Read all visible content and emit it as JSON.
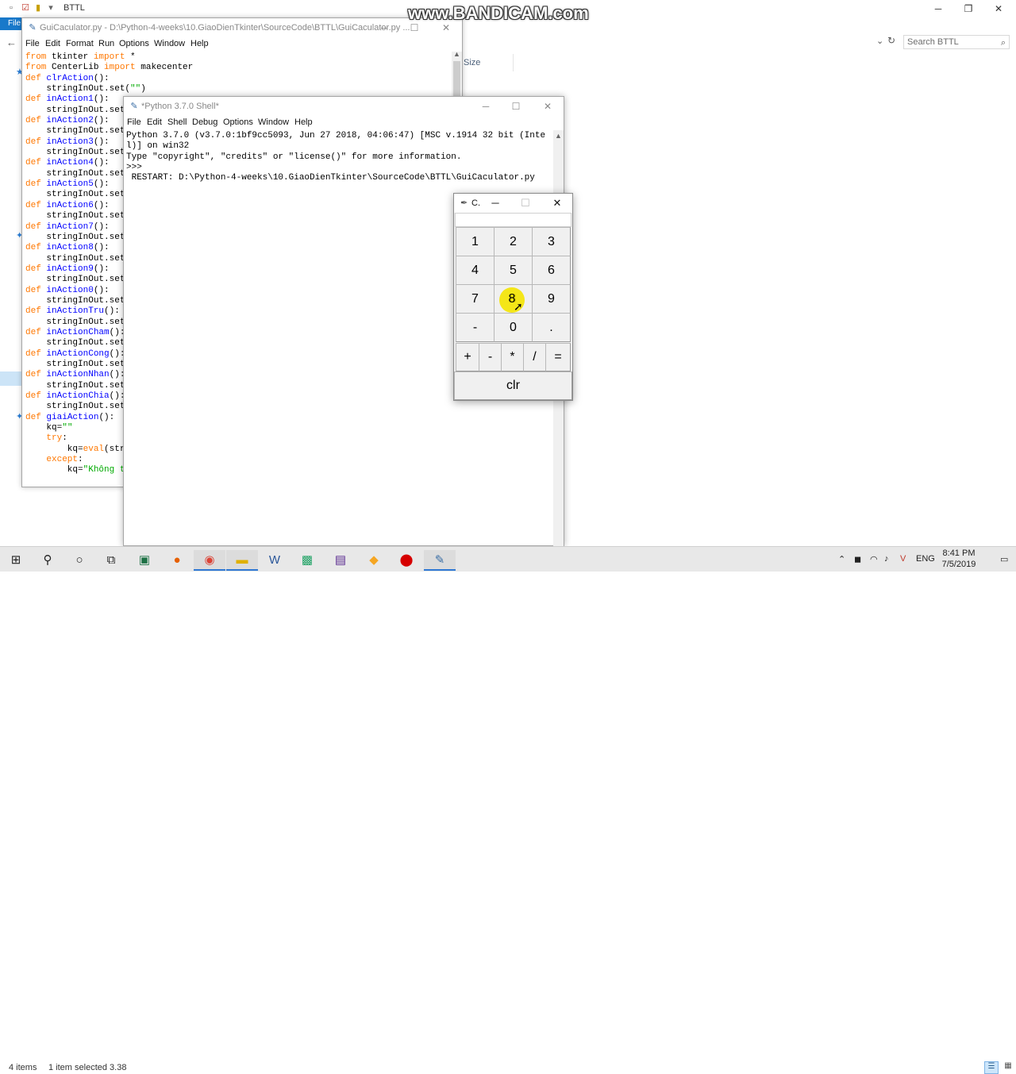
{
  "explorer": {
    "title": "BTTL",
    "file_tab": "File",
    "search_placeholder": "Search BTTL",
    "col_size": "Size",
    "items_count": "4 items",
    "selected": "1 item selected  3.38"
  },
  "watermark": "www.BANDICAM.com",
  "editor": {
    "title": "GuiCaculator.py - D:\\Python-4-weeks\\10.GiaoDienTkinter\\SourceCode\\BTTL\\GuiCaculator.py ...",
    "menu": [
      "File",
      "Edit",
      "Format",
      "Run",
      "Options",
      "Window",
      "Help"
    ]
  },
  "shell": {
    "title": "*Python 3.7.0 Shell*",
    "menu": [
      "File",
      "Edit",
      "Shell",
      "Debug",
      "Options",
      "Window",
      "Help"
    ],
    "lines": [
      "Python 3.7.0 (v3.7.0:1bf9cc5093, Jun 27 2018, 04:06:47) [MSC v.1914 32 bit (Inte",
      "l)] on win32",
      "Type \"copyright\", \"credits\" or \"license()\" for more information.",
      ">>>",
      " RESTART: D:\\Python-4-weeks\\10.GiaoDienTkinter\\SourceCode\\BTTL\\GuiCaculator.py"
    ]
  },
  "calc": {
    "title": "C.",
    "entry_value": "",
    "digit_rows": [
      [
        "1",
        "2",
        "3"
      ],
      [
        "4",
        "5",
        "6"
      ],
      [
        "7",
        "8",
        "9"
      ],
      [
        "-",
        "0",
        "."
      ]
    ],
    "op_row": [
      "+",
      "-",
      "*",
      "/",
      "="
    ],
    "clear_label": "clr",
    "pressed_key": "8"
  },
  "taskbar": {
    "time": "8:41 PM",
    "date": "7/5/2019",
    "language": "ENG"
  },
  "colors": {
    "keyword": "#ff7700",
    "function_name": "#0000ff",
    "string": "#00aa00",
    "highlight": "#f4e400",
    "file_tab": "#1979ca"
  }
}
